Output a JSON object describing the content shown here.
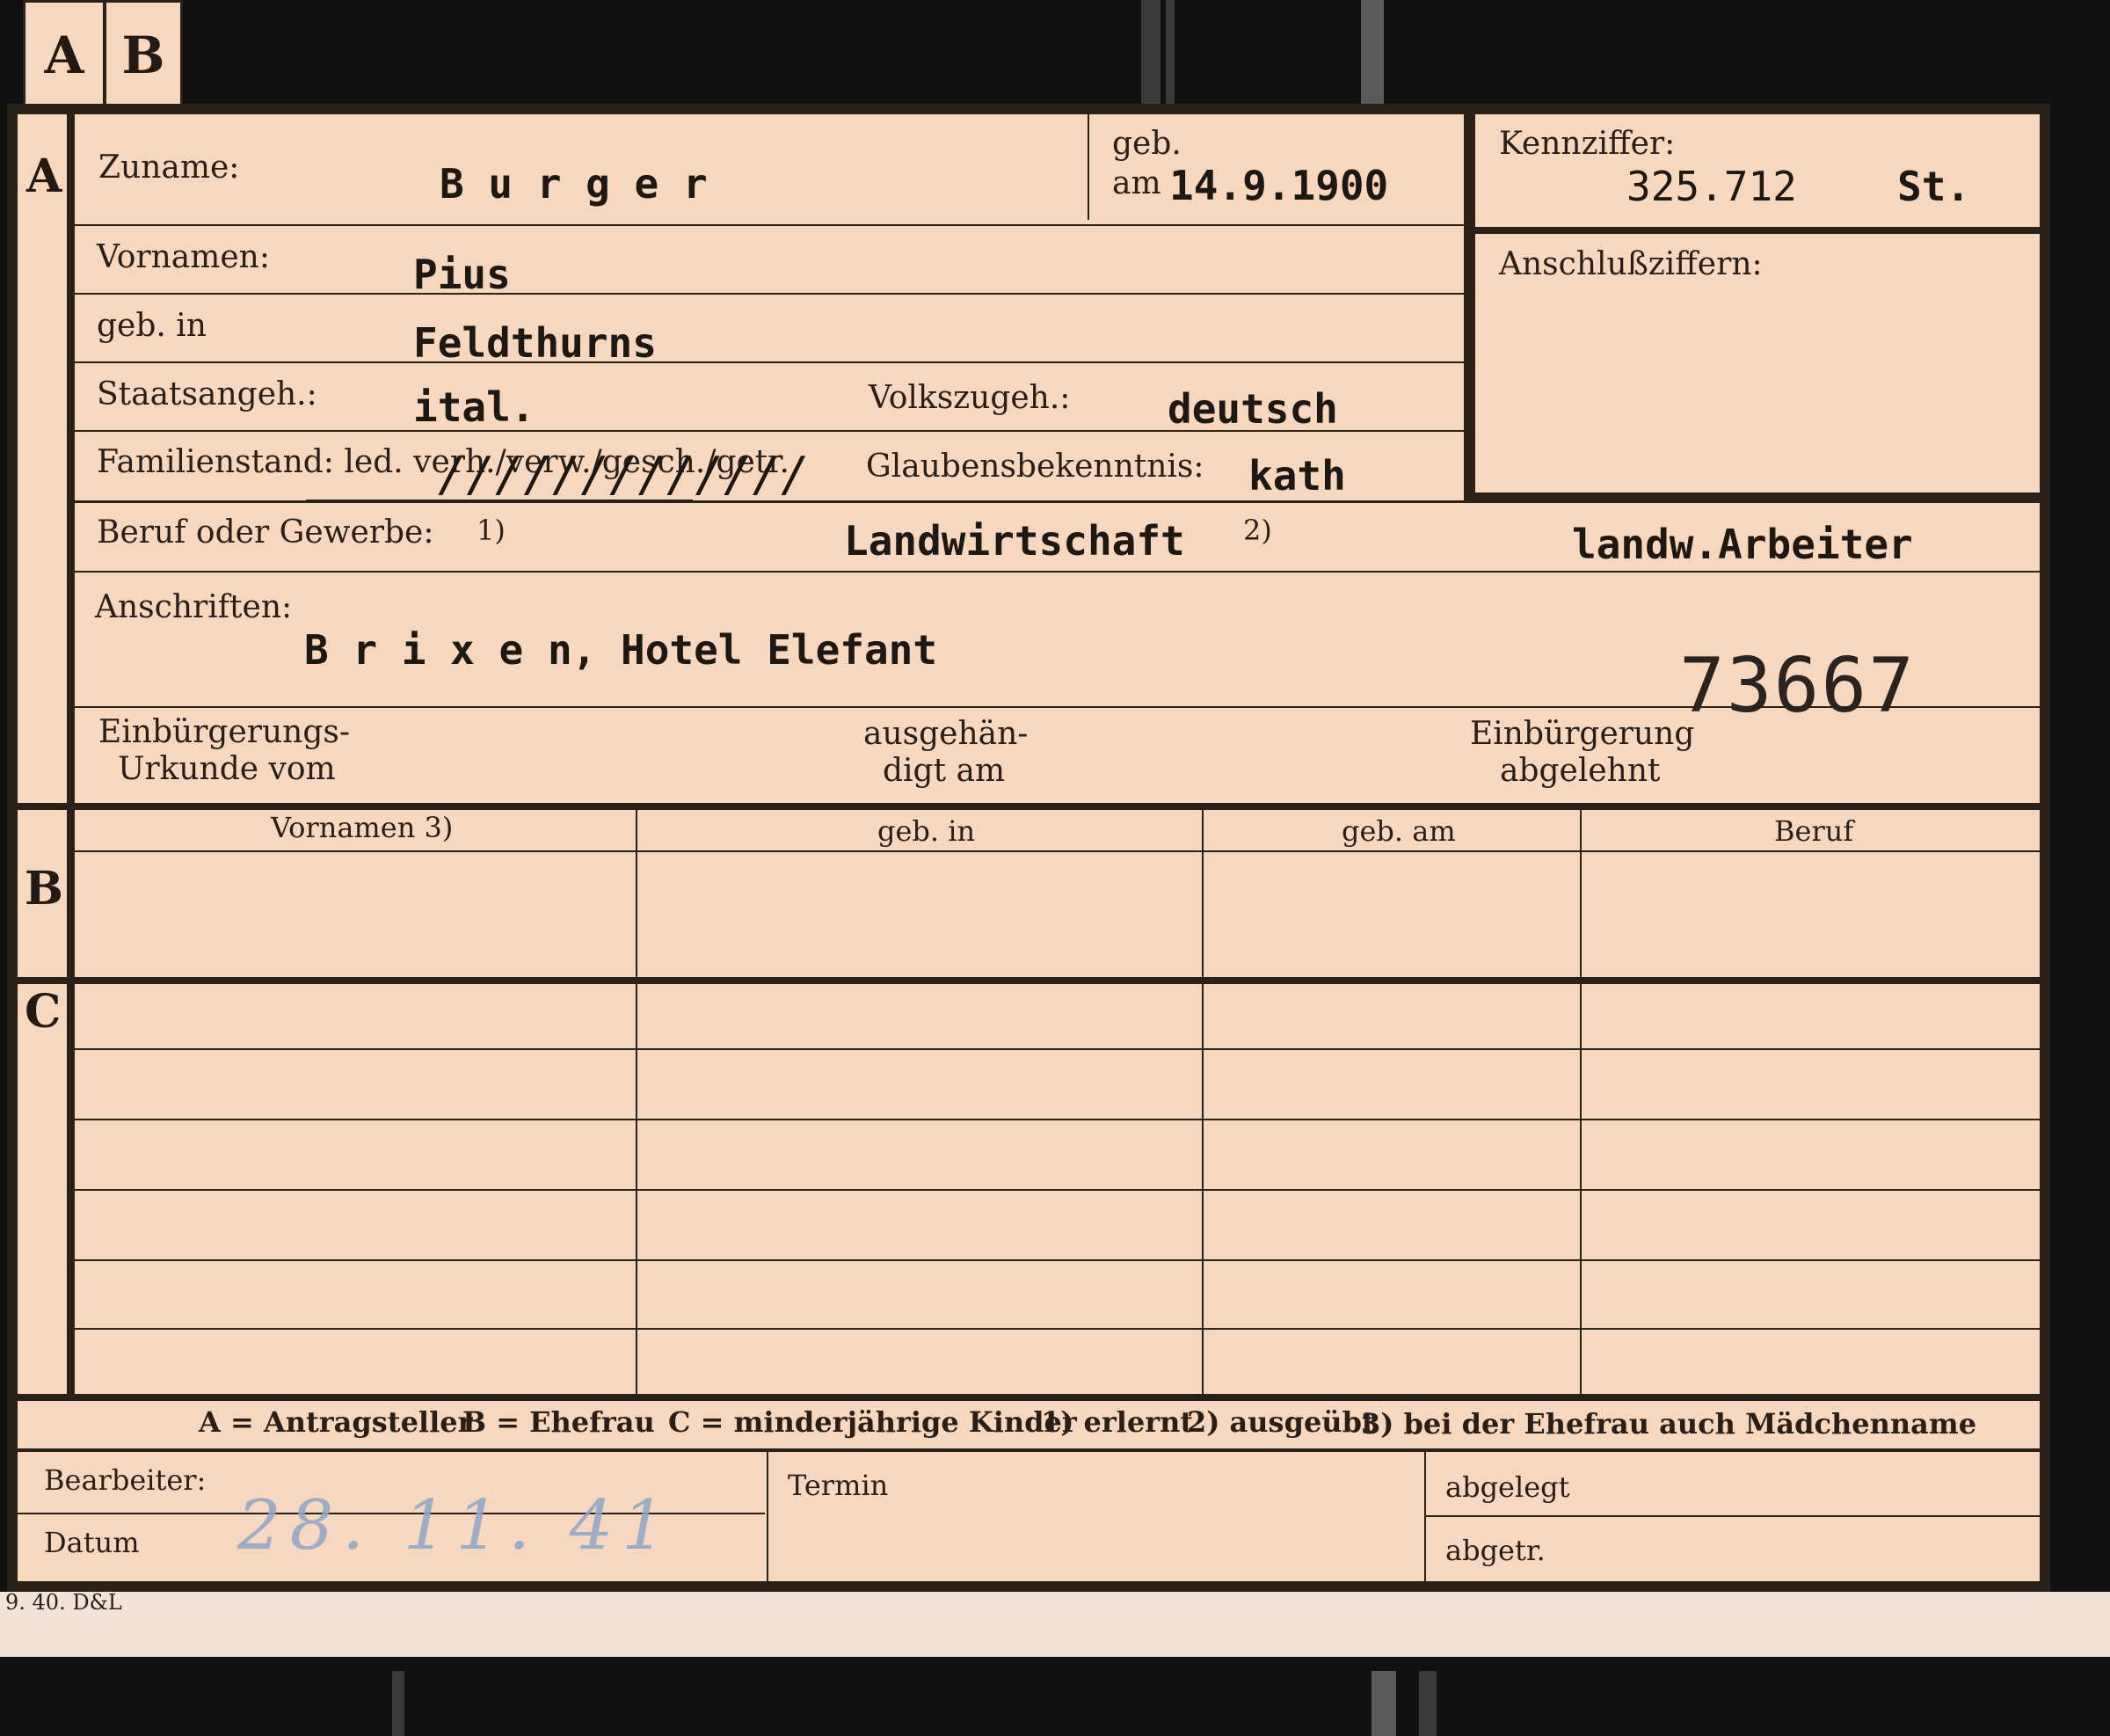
{
  "tabs": [
    "A",
    "B"
  ],
  "sections": {
    "a": "A",
    "b": "B",
    "c": "C"
  },
  "fields": {
    "zuname_label": "Zuname:",
    "zuname_value": "B u r g e r",
    "geb_label": "geb.",
    "am_label": "am",
    "geb_am_value": "14.9.1900",
    "kennziffer_label": "Kennziffer:",
    "kennziffer_value": "325.712",
    "kennziffer_suffix": "St.",
    "anschluss_label": "Anschlußziffern:",
    "vornamen_label": "Vornamen:",
    "vornamen_value": "Pius",
    "geb_in_label": "geb. in",
    "geb_in_value": "Feldthurns",
    "staat_label": "Staatsangeh.:",
    "staat_value": "ital.",
    "volk_label": "Volkszugeh.:",
    "volk_value": "deutsch",
    "familienstand_label": "Familienstand: led. verh./verw./gesch./getr.",
    "familienstand_strike": "/////////////",
    "glaube_label": "Glaubensbekenntnis:",
    "glaube_value": "kath",
    "beruf_label": "Beruf oder Gewerbe:",
    "note1": "1)",
    "beruf_value1": "Landwirtschaft",
    "note2": "2)",
    "beruf_value2": "landw.Arbeiter",
    "anschriften_label": "Anschriften:",
    "anschriften_value": "B r i x e n,  Hotel Elefant",
    "stamp_number": "73667",
    "einb_urkunde_line1": "Einbürgerungs-",
    "einb_urkunde_line2": "Urkunde vom",
    "ausgehaendigt_line1": "ausgehän-",
    "ausgehaendigt_line2": "digt am",
    "einb_abgelehnt_line1": "Einbürgerung",
    "einb_abgelehnt_line2": "abgelehnt"
  },
  "table": {
    "headers": [
      "Vornamen 3)",
      "geb. in",
      "geb. am",
      "Beruf"
    ]
  },
  "legend": {
    "a": "A = Antragsteller",
    "b": "B = Ehefrau",
    "c": "C = minderjährige Kinder",
    "n1": "1) erlernt",
    "n2": "2) ausgeübt",
    "n3": "3) bei der Ehefrau auch Mädchenname"
  },
  "footer": {
    "bearbeiter_label": "Bearbeiter:",
    "datum_label": "Datum",
    "datum_handwritten": "28. 11. 41",
    "termin_label": "Termin",
    "abgelegt_label": "abgelegt",
    "abgetr_label": "abgetr."
  },
  "print_code": "9. 40. D&L"
}
